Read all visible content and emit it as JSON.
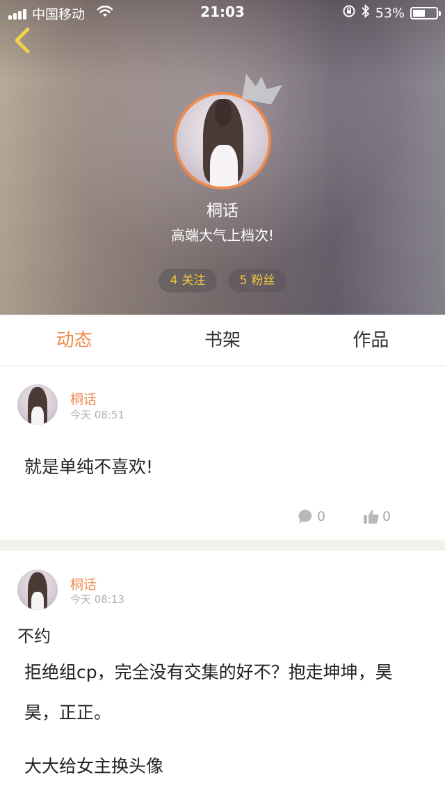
{
  "status_bar": {
    "carrier": "中国移动",
    "time": "21:03",
    "battery_percent_label": "53%",
    "battery_level": 0.53
  },
  "profile": {
    "name": "桐话",
    "bio": "高端大气上档次!",
    "stats": {
      "following": {
        "count": "4",
        "label": "关注"
      },
      "fans": {
        "count": "5",
        "label": "粉丝"
      }
    }
  },
  "tabs": [
    {
      "label": "动态",
      "active": true
    },
    {
      "label": "书架",
      "active": false
    },
    {
      "label": "作品",
      "active": false
    }
  ],
  "posts": [
    {
      "author": "桐话",
      "time": "今天 08:51",
      "title": "",
      "text": "就是单纯不喜欢!",
      "comments": "0",
      "likes": "0"
    },
    {
      "author": "桐话",
      "time": "今天 08:13",
      "title": "不约",
      "text": "拒绝组cp，完全没有交集的好不？抱走坤坤，昊昊，正正。",
      "extra": "大大给女主换头像"
    }
  ],
  "colors": {
    "accent": "#ef8a4c",
    "stat_text": "#f5c93a",
    "muted": "#b0b0b0",
    "divider_bg": "#f3f1ec"
  },
  "icons": {
    "back": "chevron-left-icon",
    "crown": "crown-icon",
    "comment": "comment-bubble-icon",
    "like": "thumbs-up-icon"
  }
}
